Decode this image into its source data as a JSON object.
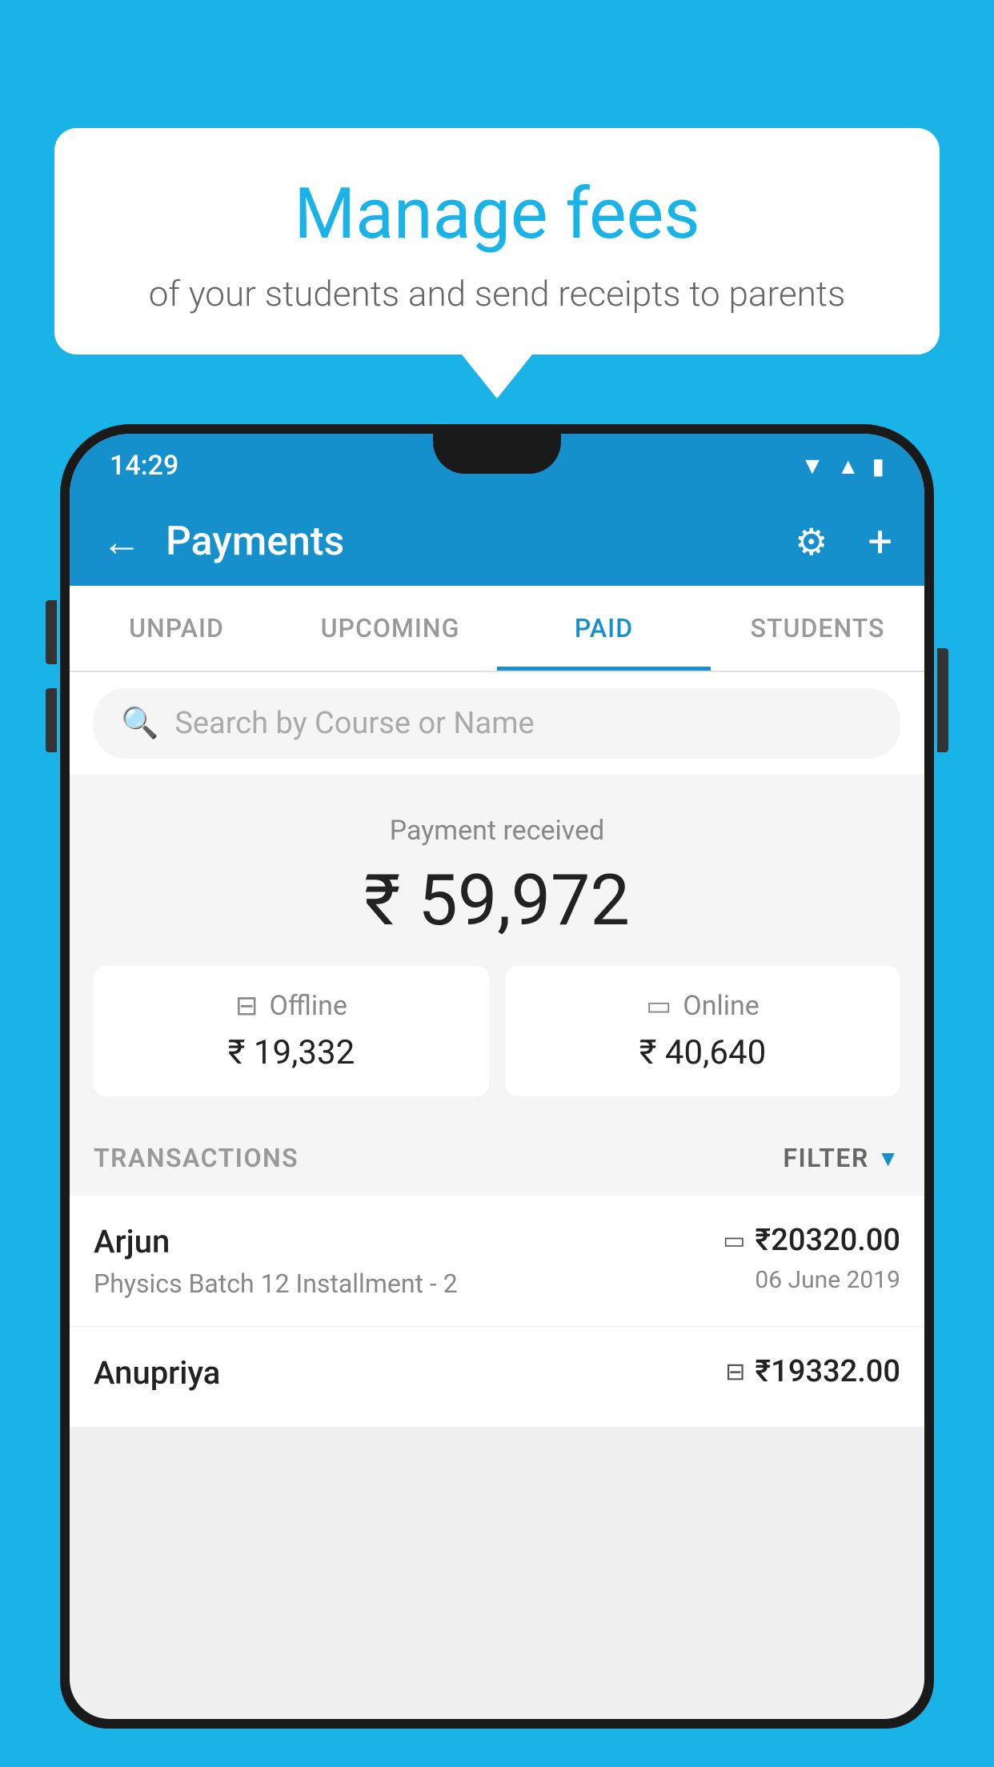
{
  "background_color": "#1ab3e8",
  "speech_bubble": {
    "title": "Manage fees",
    "subtitle": "of your students and send receipts to parents"
  },
  "status_bar": {
    "time": "14:29"
  },
  "app_bar": {
    "title": "Payments",
    "back_label": "←",
    "gear_label": "⚙",
    "plus_label": "+"
  },
  "tabs": [
    {
      "label": "UNPAID",
      "active": false
    },
    {
      "label": "UPCOMING",
      "active": false
    },
    {
      "label": "PAID",
      "active": true
    },
    {
      "label": "STUDENTS",
      "active": false
    }
  ],
  "search": {
    "placeholder": "Search by Course or Name"
  },
  "payment": {
    "received_label": "Payment received",
    "total_amount": "₹ 59,972",
    "offline_label": "Offline",
    "offline_amount": "₹ 19,332",
    "online_label": "Online",
    "online_amount": "₹ 40,640"
  },
  "transactions": {
    "header_label": "TRANSACTIONS",
    "filter_label": "FILTER",
    "items": [
      {
        "name": "Arjun",
        "detail": "Physics Batch 12 Installment - 2",
        "amount": "₹20320.00",
        "date": "06 June 2019",
        "payment_type": "card"
      },
      {
        "name": "Anupriya",
        "detail": "",
        "amount": "₹19332.00",
        "date": "",
        "payment_type": "offline"
      }
    ]
  }
}
